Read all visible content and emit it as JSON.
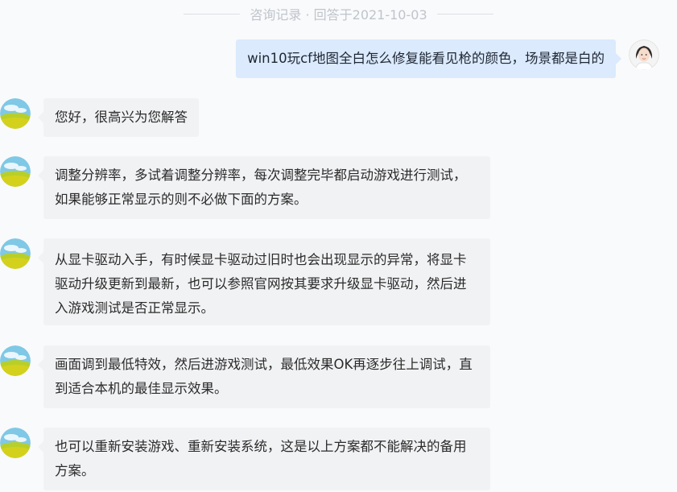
{
  "header": {
    "text": "咨询记录 · 回答于2021-10-03"
  },
  "messages": [
    {
      "role": "user",
      "text": "win10玩cf地图全白怎么修复能看见枪的颜色，场景都是白的"
    },
    {
      "role": "answerer",
      "text": "您好，很高兴为您解答"
    },
    {
      "role": "answerer",
      "text": "调整分辨率，多试着调整分辨率，每次调整完毕都启动游戏进行测试，如果能够正常显示的则不必做下面的方案。"
    },
    {
      "role": "answerer",
      "text": "从显卡驱动入手，有时候显卡驱动过旧时也会出现显示的异常，将显卡驱动升级更新到最新，也可以参照官网按其要求升级显卡驱动，然后进入游戏测试是否正常显示。"
    },
    {
      "role": "answerer",
      "text": "画面调到最低特效，然后进游戏测试，最低效果OK再逐步往上调试，直到适合本机的最佳显示效果。"
    },
    {
      "role": "answerer",
      "text": "也可以重新安装游戏、重新安装系统，这是以上方案都不能解决的备用方案。"
    }
  ],
  "avatars": {
    "user": "user-avatar",
    "answerer": "answerer-avatar"
  }
}
